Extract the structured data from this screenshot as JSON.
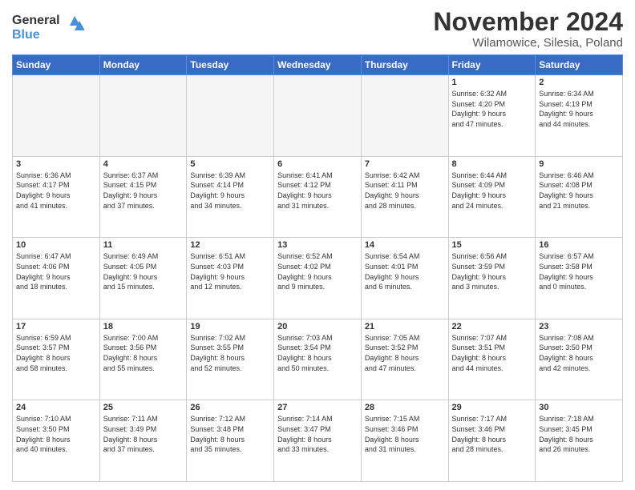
{
  "header": {
    "logo_line1": "General",
    "logo_line2": "Blue",
    "month": "November 2024",
    "location": "Wilamowice, Silesia, Poland"
  },
  "days_of_week": [
    "Sunday",
    "Monday",
    "Tuesday",
    "Wednesday",
    "Thursday",
    "Friday",
    "Saturday"
  ],
  "weeks": [
    [
      {
        "day": "",
        "info": ""
      },
      {
        "day": "",
        "info": ""
      },
      {
        "day": "",
        "info": ""
      },
      {
        "day": "",
        "info": ""
      },
      {
        "day": "",
        "info": ""
      },
      {
        "day": "1",
        "info": "Sunrise: 6:32 AM\nSunset: 4:20 PM\nDaylight: 9 hours\nand 47 minutes."
      },
      {
        "day": "2",
        "info": "Sunrise: 6:34 AM\nSunset: 4:19 PM\nDaylight: 9 hours\nand 44 minutes."
      }
    ],
    [
      {
        "day": "3",
        "info": "Sunrise: 6:36 AM\nSunset: 4:17 PM\nDaylight: 9 hours\nand 41 minutes."
      },
      {
        "day": "4",
        "info": "Sunrise: 6:37 AM\nSunset: 4:15 PM\nDaylight: 9 hours\nand 37 minutes."
      },
      {
        "day": "5",
        "info": "Sunrise: 6:39 AM\nSunset: 4:14 PM\nDaylight: 9 hours\nand 34 minutes."
      },
      {
        "day": "6",
        "info": "Sunrise: 6:41 AM\nSunset: 4:12 PM\nDaylight: 9 hours\nand 31 minutes."
      },
      {
        "day": "7",
        "info": "Sunrise: 6:42 AM\nSunset: 4:11 PM\nDaylight: 9 hours\nand 28 minutes."
      },
      {
        "day": "8",
        "info": "Sunrise: 6:44 AM\nSunset: 4:09 PM\nDaylight: 9 hours\nand 24 minutes."
      },
      {
        "day": "9",
        "info": "Sunrise: 6:46 AM\nSunset: 4:08 PM\nDaylight: 9 hours\nand 21 minutes."
      }
    ],
    [
      {
        "day": "10",
        "info": "Sunrise: 6:47 AM\nSunset: 4:06 PM\nDaylight: 9 hours\nand 18 minutes."
      },
      {
        "day": "11",
        "info": "Sunrise: 6:49 AM\nSunset: 4:05 PM\nDaylight: 9 hours\nand 15 minutes."
      },
      {
        "day": "12",
        "info": "Sunrise: 6:51 AM\nSunset: 4:03 PM\nDaylight: 9 hours\nand 12 minutes."
      },
      {
        "day": "13",
        "info": "Sunrise: 6:52 AM\nSunset: 4:02 PM\nDaylight: 9 hours\nand 9 minutes."
      },
      {
        "day": "14",
        "info": "Sunrise: 6:54 AM\nSunset: 4:01 PM\nDaylight: 9 hours\nand 6 minutes."
      },
      {
        "day": "15",
        "info": "Sunrise: 6:56 AM\nSunset: 3:59 PM\nDaylight: 9 hours\nand 3 minutes."
      },
      {
        "day": "16",
        "info": "Sunrise: 6:57 AM\nSunset: 3:58 PM\nDaylight: 9 hours\nand 0 minutes."
      }
    ],
    [
      {
        "day": "17",
        "info": "Sunrise: 6:59 AM\nSunset: 3:57 PM\nDaylight: 8 hours\nand 58 minutes."
      },
      {
        "day": "18",
        "info": "Sunrise: 7:00 AM\nSunset: 3:56 PM\nDaylight: 8 hours\nand 55 minutes."
      },
      {
        "day": "19",
        "info": "Sunrise: 7:02 AM\nSunset: 3:55 PM\nDaylight: 8 hours\nand 52 minutes."
      },
      {
        "day": "20",
        "info": "Sunrise: 7:03 AM\nSunset: 3:54 PM\nDaylight: 8 hours\nand 50 minutes."
      },
      {
        "day": "21",
        "info": "Sunrise: 7:05 AM\nSunset: 3:52 PM\nDaylight: 8 hours\nand 47 minutes."
      },
      {
        "day": "22",
        "info": "Sunrise: 7:07 AM\nSunset: 3:51 PM\nDaylight: 8 hours\nand 44 minutes."
      },
      {
        "day": "23",
        "info": "Sunrise: 7:08 AM\nSunset: 3:50 PM\nDaylight: 8 hours\nand 42 minutes."
      }
    ],
    [
      {
        "day": "24",
        "info": "Sunrise: 7:10 AM\nSunset: 3:50 PM\nDaylight: 8 hours\nand 40 minutes."
      },
      {
        "day": "25",
        "info": "Sunrise: 7:11 AM\nSunset: 3:49 PM\nDaylight: 8 hours\nand 37 minutes."
      },
      {
        "day": "26",
        "info": "Sunrise: 7:12 AM\nSunset: 3:48 PM\nDaylight: 8 hours\nand 35 minutes."
      },
      {
        "day": "27",
        "info": "Sunrise: 7:14 AM\nSunset: 3:47 PM\nDaylight: 8 hours\nand 33 minutes."
      },
      {
        "day": "28",
        "info": "Sunrise: 7:15 AM\nSunset: 3:46 PM\nDaylight: 8 hours\nand 31 minutes."
      },
      {
        "day": "29",
        "info": "Sunrise: 7:17 AM\nSunset: 3:46 PM\nDaylight: 8 hours\nand 28 minutes."
      },
      {
        "day": "30",
        "info": "Sunrise: 7:18 AM\nSunset: 3:45 PM\nDaylight: 8 hours\nand 26 minutes."
      }
    ]
  ]
}
